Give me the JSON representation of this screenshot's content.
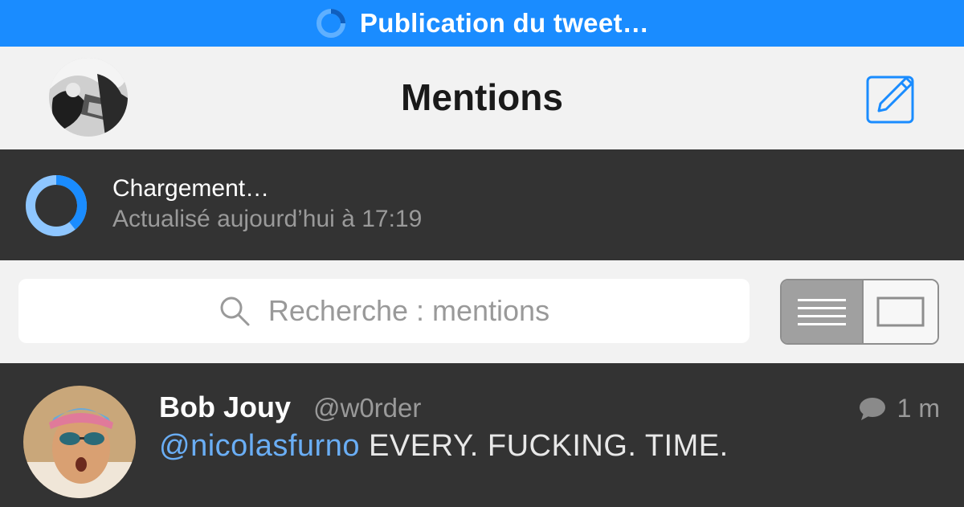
{
  "status_bar": {
    "text": "Publication du tweet…"
  },
  "nav": {
    "title": "Mentions"
  },
  "loading": {
    "title": "Chargement…",
    "subtitle": "Actualisé aujourd’hui à 17:19"
  },
  "search": {
    "placeholder": "Recherche : mentions"
  },
  "view_toggle": {
    "selected": "list",
    "options": [
      "list-view",
      "card-view"
    ]
  },
  "tweet": {
    "name": "Bob Jouy",
    "handle": "@w0rder",
    "time": "1 m",
    "mention": "@nicolasfurno",
    "text": " EVERY. FUCKING. TIME."
  },
  "colors": {
    "accent": "#1a8cff",
    "dark_bg": "#333333",
    "mention": "#6aaef5"
  }
}
